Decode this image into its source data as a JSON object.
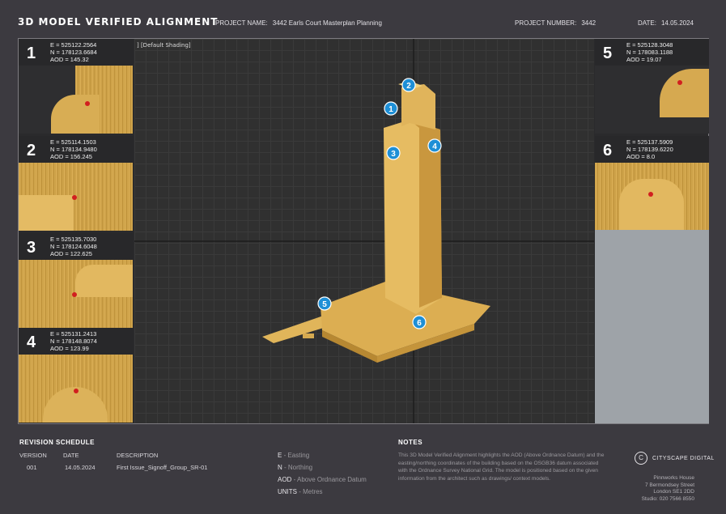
{
  "header": {
    "title": "3D MODEL VERIFIED ALIGNMENT",
    "project_name_label": "PROJECT NAME:",
    "project_name": "3442 Earls Court Masterplan Planning",
    "project_number_label": "PROJECT NUMBER:",
    "project_number": "3442",
    "date_label": "DATE:",
    "date": "14.05.2024"
  },
  "viewport": {
    "label": "] [Default Shading]",
    "markers": [
      "1",
      "2",
      "3",
      "4",
      "5",
      "6"
    ],
    "model_color": "#e2b85c"
  },
  "panels": [
    {
      "num": "1",
      "e": "E = 525122.2564",
      "n": "N = 178123.6684",
      "aod": "AOD = 145.32"
    },
    {
      "num": "2",
      "e": "E = 525114.1503",
      "n": "N = 178134.9480",
      "aod": "AOD = 156.245"
    },
    {
      "num": "3",
      "e": "E = 525135.7030",
      "n": "N = 178124.6048",
      "aod": "AOD = 122.625"
    },
    {
      "num": "4",
      "e": "E = 525131.2413",
      "n": "N = 178148.8074",
      "aod": "AOD = 123.99"
    },
    {
      "num": "5",
      "e": "E = 525128.3048",
      "n": "N = 178083.1188",
      "aod": "AOD = 19.07"
    },
    {
      "num": "6",
      "e": "E = 525137.5909",
      "n": "N = 178139.6220",
      "aod": "AOD = 8.0"
    }
  ],
  "revision": {
    "title": "REVISION SCHEDULE",
    "headers": [
      "VERSION",
      "DATE",
      "DESCRIPTION"
    ],
    "rows": [
      [
        "001",
        "14.05.2024",
        "First Issue_Signoff_Group_SR-01"
      ]
    ]
  },
  "legend": [
    {
      "key": "E",
      "desc": " - Easting"
    },
    {
      "key": "N",
      "desc": " - Northing"
    },
    {
      "key": "AOD",
      "desc": " - Above Ordnance Datum"
    },
    {
      "key": "UNITS",
      "desc": " - Metres"
    }
  ],
  "notes": {
    "title": "NOTES",
    "text": "This 3D Model Verified Alignment highlights the AOD (Above Ordnance Datum) and the easting/northing coordinates of the building based on the OSGB36 datum associated with the Ordnance Survey National Grid. The model is positioned based on the given information from the architect such as drawings/ context models."
  },
  "company": {
    "logo_letter": "C",
    "name": "CITYSCAPE DIGITAL",
    "address": [
      "Pinnworks House",
      "7 Bermondsey Street",
      "London SE1 2DD",
      "Studio: 020 7566 8550"
    ]
  },
  "colors": {
    "accent_marker": "#1e8fd6",
    "point": "#d11f1f"
  }
}
